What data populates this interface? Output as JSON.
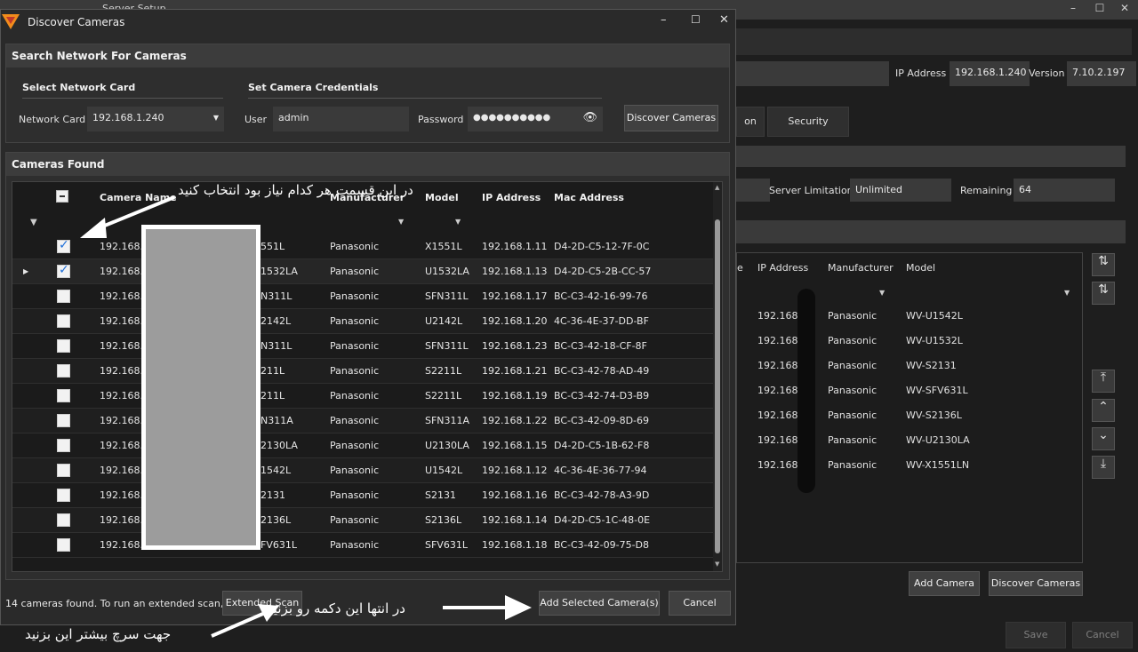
{
  "background_window": {
    "title": "Server Setup",
    "ip_address_label": "IP Address",
    "ip_address_value": "192.168.1.240",
    "version_label": "Version",
    "version_value": "7.10.2.197",
    "tabs": [
      "on",
      "Security"
    ],
    "server_limitation_label": "Server Limitation",
    "server_limitation_value": "Unlimited",
    "remaining_label": "Remaining",
    "remaining_value": "64",
    "table_headers": [
      "e",
      "IP Address",
      "Manufacturer",
      "Model"
    ],
    "rows": [
      {
        "ip": "192.168.1",
        "manufacturer": "Panasonic",
        "model": "WV-U1542L"
      },
      {
        "ip": "192.168.1",
        "manufacturer": "Panasonic",
        "model": "WV-U1532L"
      },
      {
        "ip": "192.168",
        "manufacturer": "Panasonic",
        "model": "WV-S2131"
      },
      {
        "ip": "192.168.1",
        "manufacturer": "Panasonic",
        "model": "WV-SFV631L"
      },
      {
        "ip": "192.168.1",
        "manufacturer": "Panasonic",
        "model": "WV-S2136L"
      },
      {
        "ip": "192.168.1",
        "manufacturer": "Panasonic",
        "model": "WV-U2130LA"
      },
      {
        "ip": "192.168.1.",
        "manufacturer": "Panasonic",
        "model": "WV-X1551LN"
      }
    ],
    "add_camera_label": "Add Camera",
    "discover_cameras_label": "Discover Cameras",
    "save_label": "Save",
    "cancel_label": "Cancel"
  },
  "dialog": {
    "title": "Discover Cameras",
    "search_section_title": "Search Network For Cameras",
    "select_network_card_title": "Select Network Card",
    "set_credentials_title": "Set Camera Credentials",
    "network_card_label": "Network Card",
    "network_card_value": "192.168.1.240",
    "user_label": "User",
    "user_value": "admin",
    "password_label": "Password",
    "password_value": "●●●●●●●●●●",
    "discover_button_label": "Discover Cameras",
    "cameras_found_title": "Cameras Found",
    "columns": {
      "camera_name": "Camera Name",
      "manufacturer": "Manufacturer",
      "model": "Model",
      "ip_address": "IP Address",
      "mac_address": "Mac Address"
    },
    "cameras": [
      {
        "checked": true,
        "name": "192.168.1",
        "name_tail": "551L",
        "manufacturer": "Panasonic",
        "model": "X1551L",
        "ip": "192.168.1.11",
        "mac": "D4-2D-C5-12-7F-0C"
      },
      {
        "checked": true,
        "name": "192.168.1",
        "name_tail": "1532LA",
        "manufacturer": "Panasonic",
        "model": "U1532LA",
        "ip": "192.168.1.13",
        "mac": "D4-2D-C5-2B-CC-57"
      },
      {
        "checked": false,
        "name": "192.168.1",
        "name_tail": "N311L",
        "manufacturer": "Panasonic",
        "model": "SFN311L",
        "ip": "192.168.1.17",
        "mac": "BC-C3-42-16-99-76"
      },
      {
        "checked": false,
        "name": "192.168.1",
        "name_tail": "2142L",
        "manufacturer": "Panasonic",
        "model": "U2142L",
        "ip": "192.168.1.20",
        "mac": "4C-36-4E-37-DD-BF"
      },
      {
        "checked": false,
        "name": "192.168.1",
        "name_tail": "N311L",
        "manufacturer": "Panasonic",
        "model": "SFN311L",
        "ip": "192.168.1.23",
        "mac": "BC-C3-42-18-CF-8F"
      },
      {
        "checked": false,
        "name": "192.168.1",
        "name_tail": "211L",
        "manufacturer": "Panasonic",
        "model": "S2211L",
        "ip": "192.168.1.21",
        "mac": "BC-C3-42-78-AD-49"
      },
      {
        "checked": false,
        "name": "192.168.1",
        "name_tail": "211L",
        "manufacturer": "Panasonic",
        "model": "S2211L",
        "ip": "192.168.1.19",
        "mac": "BC-C3-42-74-D3-B9"
      },
      {
        "checked": false,
        "name": "192.168.1",
        "name_tail": "N311A",
        "manufacturer": "Panasonic",
        "model": "SFN311A",
        "ip": "192.168.1.22",
        "mac": "BC-C3-42-09-8D-69"
      },
      {
        "checked": false,
        "name": "192.168.1",
        "name_tail": "2130LA",
        "manufacturer": "Panasonic",
        "model": "U2130LA",
        "ip": "192.168.1.15",
        "mac": "D4-2D-C5-1B-62-F8"
      },
      {
        "checked": false,
        "name": "192.168.1",
        "name_tail": "1542L",
        "manufacturer": "Panasonic",
        "model": "U1542L",
        "ip": "192.168.1.12",
        "mac": "4C-36-4E-36-77-94"
      },
      {
        "checked": false,
        "name": "192.168.1",
        "name_tail": "2131",
        "manufacturer": "Panasonic",
        "model": "S2131",
        "ip": "192.168.1.16",
        "mac": "BC-C3-42-78-A3-9D"
      },
      {
        "checked": false,
        "name": "192.168.1",
        "name_tail": "2136L",
        "manufacturer": "Panasonic",
        "model": "S2136L",
        "ip": "192.168.1.14",
        "mac": "D4-2D-C5-1C-48-0E"
      },
      {
        "checked": false,
        "name": "192.168.1",
        "name_tail": "FV631L",
        "manufacturer": "Panasonic",
        "model": "SFV631L",
        "ip": "192.168.1.18",
        "mac": "BC-C3-42-09-75-D8"
      }
    ],
    "status_text": "14 cameras found. To run an extended scan, click",
    "extended_scan_label": "Extended Scan",
    "add_selected_label": "Add Selected Camera(s)",
    "cancel_label": "Cancel"
  },
  "annotations": {
    "select_hint": "در این قسمت هر کدام نیاز بود انتخاب کنید",
    "add_hint": "در انتها این دکمه رو بزنید",
    "extended_hint": "جهت سرچ بیشتر این بزنید"
  }
}
